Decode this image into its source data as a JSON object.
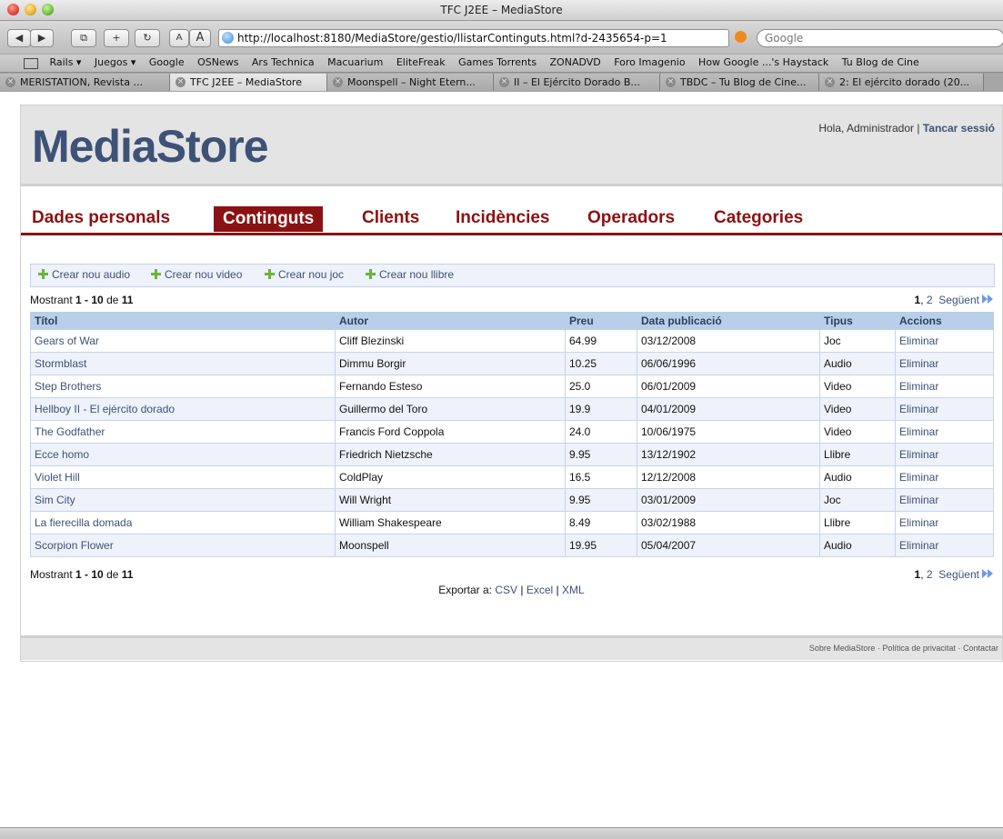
{
  "window": {
    "title": "TFC J2EE – MediaStore"
  },
  "browser": {
    "buttons": {
      "back": "◀",
      "forward": "▶",
      "snap": "⧉",
      "add": "+",
      "reload": "↻",
      "smaller_text": "A",
      "larger_text": "A"
    },
    "url": "http://localhost:8180/MediaStore/gestio/llistarContinguts.html?d-2435654-p=1",
    "search_placeholder": "Google",
    "bookmarks": [
      "Rails ▾",
      "Juegos ▾",
      "Google",
      "OSNews",
      "Ars Technica",
      "Macuarium",
      "EliteFreak",
      "Games Torrents",
      "ZONADVD",
      "Foro Imagenio",
      "How Google ...'s Haystack",
      "Tu Blog de Cine"
    ],
    "tabs": [
      {
        "label": "MERISTATION, Revista ..."
      },
      {
        "label": "TFC J2EE – MediaStore"
      },
      {
        "label": "Moonspell – Night Etern..."
      },
      {
        "label": "II – El Ejército Dorado B..."
      },
      {
        "label": "TBDC – Tu Blog de Cine..."
      },
      {
        "label": "2: El ejército dorado (20..."
      }
    ]
  },
  "header": {
    "logo": "MediaStore",
    "greeting": "Hola, Administrador",
    "separator": "|",
    "logout": "Tancar sessió"
  },
  "nav": {
    "tabs": [
      {
        "label": "Dades personals"
      },
      {
        "label": "Continguts"
      },
      {
        "label": "Clients"
      },
      {
        "label": "Incidències"
      },
      {
        "label": "Operadors"
      },
      {
        "label": "Categories"
      }
    ]
  },
  "actions": {
    "items": [
      {
        "label": "Crear nou audio"
      },
      {
        "label": "Crear nou video"
      },
      {
        "label": "Crear nou joc"
      },
      {
        "label": "Crear nou llibre"
      }
    ]
  },
  "listing": {
    "summary_prefix": "Mostrant",
    "range": "1 - 10",
    "summary_of": "de",
    "total": "11",
    "pager": {
      "current": "1",
      "comma": ",",
      "page2": "2",
      "next": "Següent"
    },
    "columns": [
      "Títol",
      "Autor",
      "Preu",
      "Data publicació",
      "Tipus",
      "Accions"
    ],
    "rows": [
      {
        "title": "Gears of War",
        "author": "Cliff Blezinski",
        "price": "64.99",
        "date": "03/12/2008",
        "type": "Joc",
        "action": "Eliminar"
      },
      {
        "title": "Stormblast",
        "author": "Dimmu Borgir",
        "price": "10.25",
        "date": "06/06/1996",
        "type": "Audio",
        "action": "Eliminar"
      },
      {
        "title": "Step Brothers",
        "author": "Fernando Esteso",
        "price": "25.0",
        "date": "06/01/2009",
        "type": "Video",
        "action": "Eliminar"
      },
      {
        "title": "Hellboy II - El ejército dorado",
        "author": "Guillermo del Toro",
        "price": "19.9",
        "date": "04/01/2009",
        "type": "Video",
        "action": "Eliminar"
      },
      {
        "title": "The Godfather",
        "author": "Francis Ford Coppola",
        "price": "24.0",
        "date": "10/06/1975",
        "type": "Video",
        "action": "Eliminar"
      },
      {
        "title": "Ecce homo",
        "author": "Friedrich Nietzsche",
        "price": "9.95",
        "date": "13/12/1902",
        "type": "Llibre",
        "action": "Eliminar"
      },
      {
        "title": "Violet Hill",
        "author": "ColdPlay",
        "price": "16.5",
        "date": "12/12/2008",
        "type": "Audio",
        "action": "Eliminar"
      },
      {
        "title": "Sim City",
        "author": "Will Wright",
        "price": "9.95",
        "date": "03/01/2009",
        "type": "Joc",
        "action": "Eliminar"
      },
      {
        "title": "La fierecilla domada",
        "author": "William Shakespeare",
        "price": "8.49",
        "date": "03/02/1988",
        "type": "Llibre",
        "action": "Eliminar"
      },
      {
        "title": "Scorpion Flower",
        "author": "Moonspell",
        "price": "19.95",
        "date": "05/04/2007",
        "type": "Audio",
        "action": "Eliminar"
      }
    ]
  },
  "export": {
    "label": "Exportar a:",
    "csv": "CSV",
    "sep": "|",
    "excel": "Excel",
    "xml": "XML"
  },
  "footer": {
    "about": "Sobre MediaStore",
    "dot": "·",
    "privacy": "Política de privacitat",
    "contact": "Contactar"
  },
  "icons": {
    "plus": "plus-icon",
    "next": "next-page-icon",
    "close_tab": "close-tab-icon",
    "globe": "globe-icon",
    "rss": "rss-icon"
  },
  "colors": {
    "brand": "#3d5276",
    "nav_accent": "#8b1212",
    "table_header": "#b9cfe9",
    "row_alt": "#eef2fb"
  }
}
